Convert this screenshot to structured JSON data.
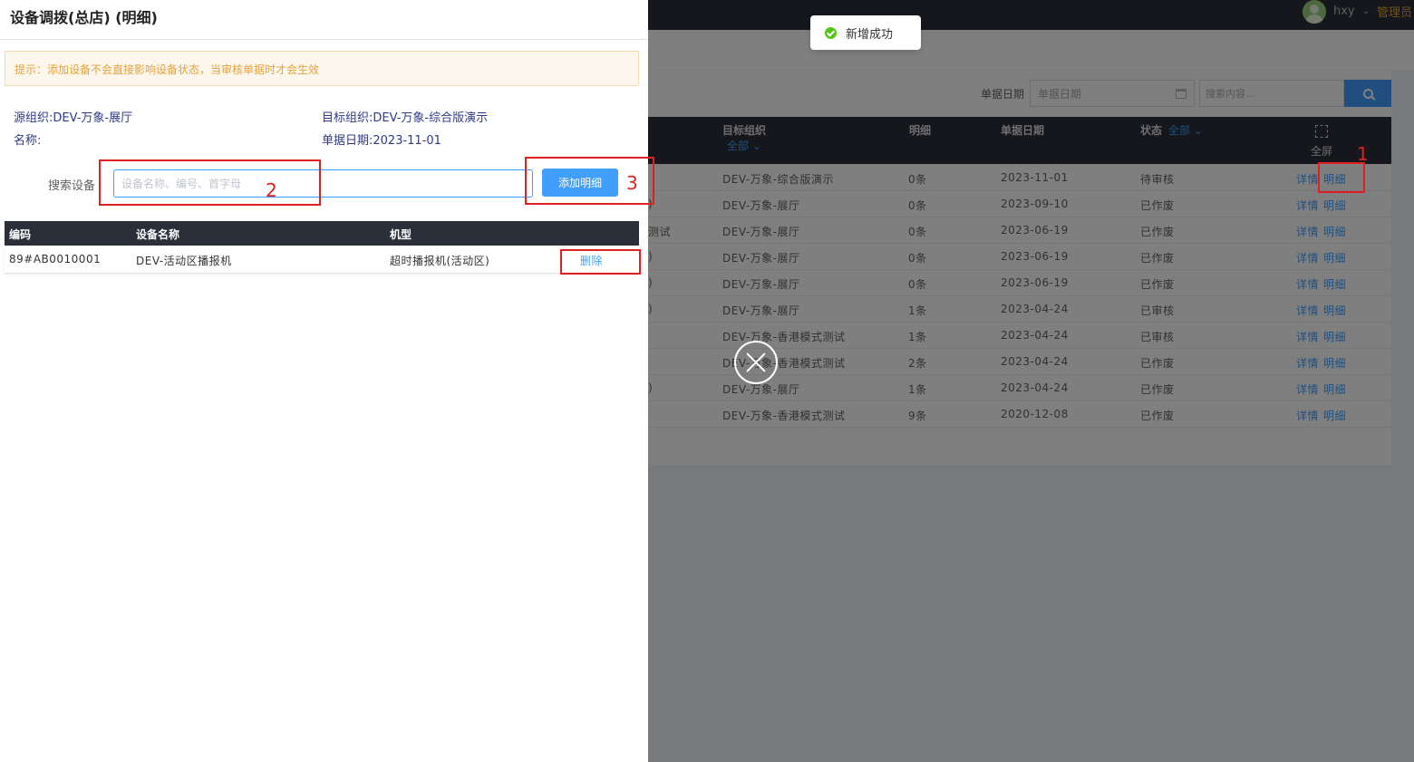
{
  "background": {
    "user": {
      "name": "hxy",
      "role": "管理员"
    },
    "filter": {
      "date_label": "单据日期",
      "date_placeholder": "单据日期",
      "search_placeholder": "搜索内容..."
    },
    "table": {
      "headers": {
        "target_org": "目标组织",
        "target_org_filter": "全部",
        "detail": "明细",
        "date": "单据日期",
        "status": "状态",
        "status_filter": "全部",
        "fullscreen": "全屏"
      },
      "rows": [
        {
          "left": "",
          "target": "DEV-万象-综合版演示",
          "count": "0条",
          "date": "2023-11-01",
          "status": "待审核"
        },
        {
          "left": ")",
          "target": "DEV-万象-展厅",
          "count": "0条",
          "date": "2023-09-10",
          "status": "已作废"
        },
        {
          "left": "测试",
          "target": "DEV-万象-展厅",
          "count": "0条",
          "date": "2023-06-19",
          "status": "已作废"
        },
        {
          "left": ")",
          "target": "DEV-万象-展厅",
          "count": "0条",
          "date": "2023-06-19",
          "status": "已作废"
        },
        {
          "left": ")",
          "target": "DEV-万象-展厅",
          "count": "0条",
          "date": "2023-06-19",
          "status": "已作废"
        },
        {
          "left": ")",
          "target": "DEV-万象-展厅",
          "count": "1条",
          "date": "2023-04-24",
          "status": "已审核"
        },
        {
          "left": "",
          "target": "DEV-万象-香港模式测试",
          "count": "1条",
          "date": "2023-04-24",
          "status": "已审核"
        },
        {
          "left": "",
          "target": "DEV-万象-香港模式测试",
          "count": "2条",
          "date": "2023-04-24",
          "status": "已作废"
        },
        {
          "left": ")",
          "target": "DEV-万象-展厅",
          "count": "1条",
          "date": "2023-04-24",
          "status": "已作废"
        },
        {
          "left": "",
          "target": "DEV-万象-香港模式测试",
          "count": "9条",
          "date": "2020-12-08",
          "status": "已作废"
        }
      ],
      "actions": {
        "detail_link": "详情",
        "items_link": "明细"
      }
    }
  },
  "toast": {
    "text": "新增成功"
  },
  "drawer": {
    "title": "设备调拨(总店) (明细)",
    "notice": "提示：添加设备不会直接影响设备状态，当审核单据时才会生效",
    "info": {
      "source_org": "源组织:DEV-万象-展厅",
      "target_org": "目标组织:DEV-万象-综合版演示",
      "name": "名称:",
      "doc_date": "单据日期:2023-11-01"
    },
    "search": {
      "label": "搜索设备",
      "placeholder": "设备名称、编号、首字母"
    },
    "add_button": "添加明细",
    "table": {
      "headers": {
        "code": "编码",
        "name": "设备名称",
        "model": "机型"
      },
      "rows": [
        {
          "code": "89#AB0010001",
          "name": "DEV-活动区播报机",
          "model": "超时播报机(活动区)",
          "action": "删除"
        }
      ]
    }
  },
  "annotations": {
    "n1": "1",
    "n2": "2",
    "n3": "3"
  }
}
